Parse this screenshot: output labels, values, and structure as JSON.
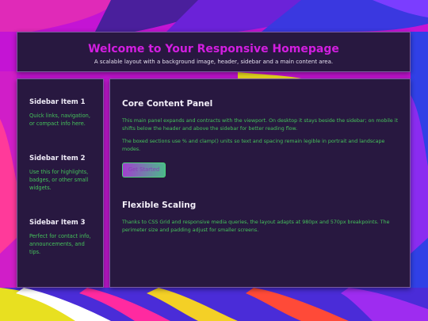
{
  "header": {
    "title": "Welcome to Your Responsive Homepage",
    "subtitle": "A scalable layout with a background image, header, sidebar and a main content area."
  },
  "sidebar": {
    "items": [
      {
        "title": "Sidebar Item 1",
        "text": "Quick links, navigation, or compact info here."
      },
      {
        "title": "Sidebar Item 2",
        "text": "Use this for highlights, badges, or other small widgets."
      },
      {
        "title": "Sidebar Item 3",
        "text": "Perfect for contact info, announcements, and tips."
      }
    ]
  },
  "main": {
    "sections": [
      {
        "title": "Core Content Panel",
        "paragraphs": [
          "This main panel expands and contracts with the viewport. On desktop it stays beside the sidebar; on mobile it shifts below the header and above the sidebar for better reading flow.",
          "The boxed sections use % and clamp() units so text and spacing remain legible in portrait and landscape modes."
        ],
        "button_label": "Get Started"
      },
      {
        "title": "Flexible Scaling",
        "paragraphs": [
          "Thanks to CSS Grid and responsive media queries, the layout adapts at 980px and 570px breakpoints. The perimeter size and padding adjust for smaller screens."
        ]
      }
    ]
  },
  "colors": {
    "panel_background": "#281840",
    "panel_border": "#7a5ca0",
    "title_accent": "#d21ee0",
    "body_text_green": "#45c25a",
    "page_background": "#c414d4"
  }
}
